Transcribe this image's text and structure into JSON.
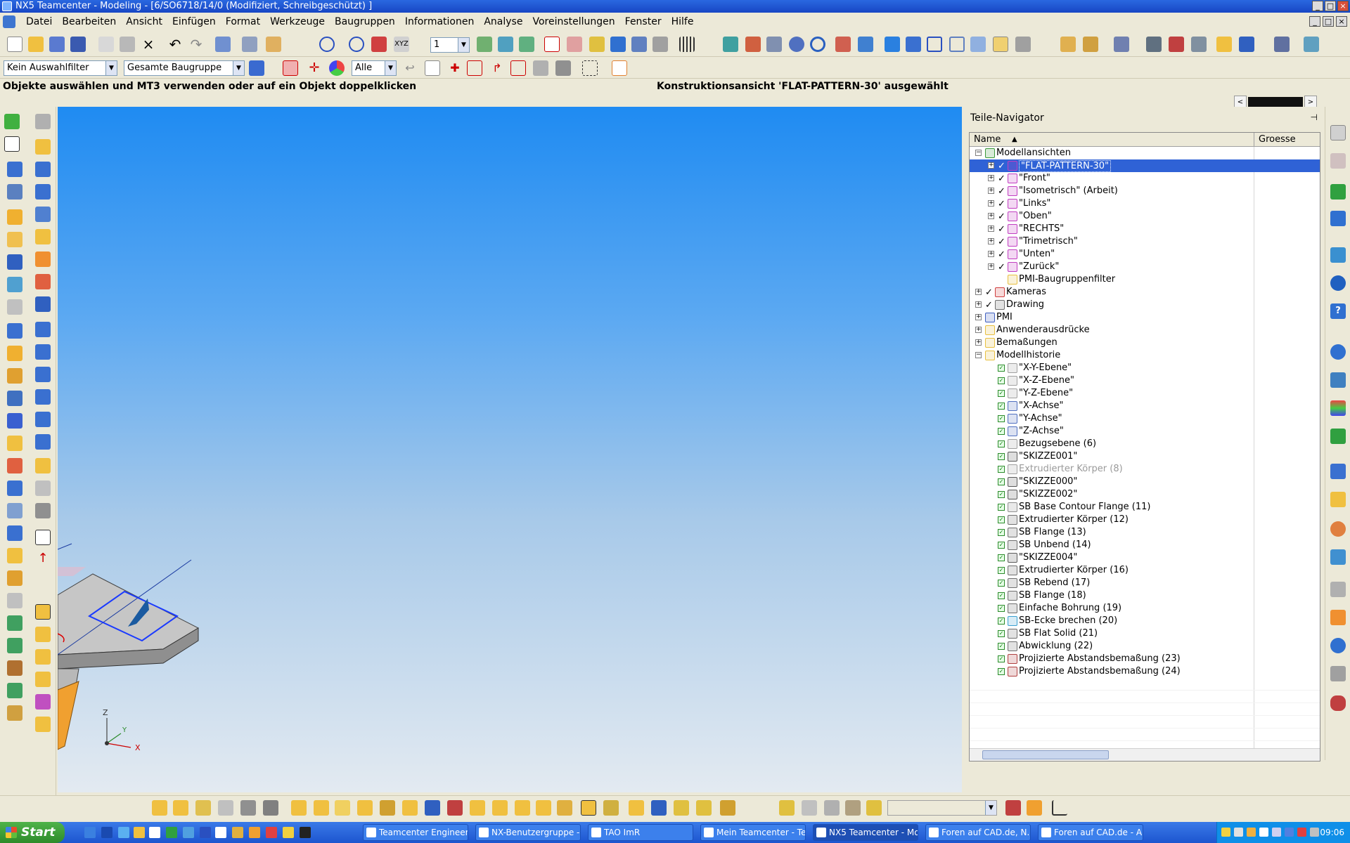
{
  "window": {
    "title": "NX5 Teamcenter - Modeling - [6/SO6718/14/0 (Modifiziert, Schreibgeschützt) ]",
    "min": "_",
    "max": "□",
    "close": "×"
  },
  "menubar": {
    "items": [
      "Datei",
      "Bearbeiten",
      "Ansicht",
      "Einfügen",
      "Format",
      "Werkzeuge",
      "Baugruppen",
      "Informationen",
      "Analyse",
      "Voreinstellungen",
      "Fenster",
      "Hilfe"
    ]
  },
  "selection_bar": {
    "filter": "Kein Auswahlfilter",
    "scope": "Gesamte Baugruppe",
    "type": "Alle",
    "layer": "1"
  },
  "status": {
    "prompt": "Objekte auswählen und MT3 verwenden oder auf ein Objekt doppelklicken",
    "message": "Konstruktionsansicht 'FLAT-PATTERN-30' ausgewählt"
  },
  "triad": {
    "z": "Z",
    "y": "Y",
    "x": "X"
  },
  "navigator": {
    "title": "Teile-Navigator",
    "pin": "⊣",
    "columns": {
      "name": "Name",
      "size": "Groesse",
      "sort": "▲"
    },
    "rows": [
      {
        "label": "Modellansichten",
        "level": 0,
        "exp": "−",
        "icon": "views-icon",
        "color": "#3a9a3a"
      },
      {
        "label": "\"FLAT-PATTERN-30\"",
        "level": 1,
        "exp": "+",
        "check": "✓",
        "icon": "view-icon",
        "color": "#c23ec2",
        "selected": true
      },
      {
        "label": "\"Front\"",
        "level": 1,
        "exp": "+",
        "check": "✓",
        "icon": "view-icon",
        "color": "#c23ec2"
      },
      {
        "label": "\"Isometrisch\" (Arbeit)",
        "level": 1,
        "exp": "+",
        "check": "✓",
        "icon": "view-icon",
        "color": "#c23ec2"
      },
      {
        "label": "\"Links\"",
        "level": 1,
        "exp": "+",
        "check": "✓",
        "icon": "view-icon",
        "color": "#c23ec2"
      },
      {
        "label": "\"Oben\"",
        "level": 1,
        "exp": "+",
        "check": "✓",
        "icon": "view-icon",
        "color": "#c23ec2"
      },
      {
        "label": "\"RECHTS\"",
        "level": 1,
        "exp": "+",
        "check": "✓",
        "icon": "view-icon",
        "color": "#c23ec2"
      },
      {
        "label": "\"Trimetrisch\"",
        "level": 1,
        "exp": "+",
        "check": "✓",
        "icon": "view-icon",
        "color": "#c23ec2"
      },
      {
        "label": "\"Unten\"",
        "level": 1,
        "exp": "+",
        "check": "✓",
        "icon": "view-icon",
        "color": "#c23ec2"
      },
      {
        "label": "\"Zurück\"",
        "level": 1,
        "exp": "+",
        "check": "✓",
        "icon": "view-icon",
        "color": "#c23ec2"
      },
      {
        "label": "PMI-Baugruppenfilter",
        "level": 1,
        "icon": "folder-icon",
        "color": "#e8c040"
      },
      {
        "label": "Kameras",
        "level": 0,
        "exp": "+",
        "check": "✓",
        "icon": "camera-icon",
        "color": "#d04040"
      },
      {
        "label": "Drawing",
        "level": 0,
        "exp": "+",
        "check": "✓",
        "icon": "drawing-icon",
        "color": "#707070"
      },
      {
        "label": "PMI",
        "level": 0,
        "exp": "+",
        "icon": "pmi-icon",
        "color": "#4060c0"
      },
      {
        "label": "Anwenderausdrücke",
        "level": 0,
        "exp": "+",
        "icon": "folder-icon",
        "color": "#e8c040"
      },
      {
        "label": "Bemaßungen",
        "level": 0,
        "exp": "+",
        "icon": "folder-icon",
        "color": "#e8c040"
      },
      {
        "label": "Modellhistorie",
        "level": 0,
        "exp": "−",
        "icon": "folder-open-icon",
        "color": "#e8c040"
      },
      {
        "label": "\"X-Y-Ebene\"",
        "level": 2,
        "box": true,
        "icon": "datum-plane-icon",
        "color": "#a0a0a0"
      },
      {
        "label": "\"X-Z-Ebene\"",
        "level": 2,
        "box": true,
        "icon": "datum-plane-icon",
        "color": "#a0a0a0"
      },
      {
        "label": "\"Y-Z-Ebene\"",
        "level": 2,
        "box": true,
        "icon": "datum-plane-icon",
        "color": "#a0a0a0"
      },
      {
        "label": "\"X-Achse\"",
        "level": 2,
        "box": true,
        "icon": "datum-axis-icon",
        "color": "#5070c0"
      },
      {
        "label": "\"Y-Achse\"",
        "level": 2,
        "box": true,
        "icon": "datum-axis-icon",
        "color": "#5070c0"
      },
      {
        "label": "\"Z-Achse\"",
        "level": 2,
        "box": true,
        "icon": "datum-axis-icon",
        "color": "#5070c0"
      },
      {
        "label": "Bezugsebene (6)",
        "level": 2,
        "box": true,
        "icon": "datum-plane-icon",
        "color": "#a0a0a0"
      },
      {
        "label": "\"SKIZZE001\"",
        "level": 2,
        "box": true,
        "icon": "sketch-icon",
        "color": "#5a5a5a"
      },
      {
        "label": "Extrudierter Körper (8)",
        "level": 2,
        "box": true,
        "icon": "extrude-icon",
        "color": "#a0a0a0",
        "dim": true
      },
      {
        "label": "\"SKIZZE000\"",
        "level": 2,
        "box": true,
        "icon": "sketch-icon",
        "color": "#5a5a5a"
      },
      {
        "label": "\"SKIZZE002\"",
        "level": 2,
        "box": true,
        "icon": "sketch-icon",
        "color": "#5a5a5a"
      },
      {
        "label": "SB Base Contour Flange (11)",
        "level": 2,
        "box": true,
        "icon": "contour-flange-icon",
        "color": "#909090"
      },
      {
        "label": "Extrudierter Körper (12)",
        "level": 2,
        "box": true,
        "icon": "extrude-icon",
        "color": "#707070"
      },
      {
        "label": "SB Flange (13)",
        "level": 2,
        "box": true,
        "icon": "flange-icon",
        "color": "#707070"
      },
      {
        "label": "SB Unbend (14)",
        "level": 2,
        "box": true,
        "icon": "unbend-icon",
        "color": "#707070"
      },
      {
        "label": "\"SKIZZE004\"",
        "level": 2,
        "box": true,
        "icon": "sketch-icon",
        "color": "#5a5a5a"
      },
      {
        "label": "Extrudierter Körper (16)",
        "level": 2,
        "box": true,
        "icon": "extrude-icon",
        "color": "#707070"
      },
      {
        "label": "SB Rebend (17)",
        "level": 2,
        "box": true,
        "icon": "rebend-icon",
        "color": "#707070"
      },
      {
        "label": "SB Flange (18)",
        "level": 2,
        "box": true,
        "icon": "flange-icon",
        "color": "#707070"
      },
      {
        "label": "Einfache Bohrung (19)",
        "level": 2,
        "box": true,
        "icon": "hole-icon",
        "color": "#707070"
      },
      {
        "label": "SB-Ecke brechen (20)",
        "level": 2,
        "box": true,
        "icon": "corner-break-icon",
        "color": "#3aa0d0"
      },
      {
        "label": "SB Flat Solid (21)",
        "level": 2,
        "box": true,
        "icon": "flat-solid-icon",
        "color": "#707070"
      },
      {
        "label": "Abwicklung (22)",
        "level": 2,
        "box": true,
        "icon": "flat-pattern-icon",
        "color": "#707070"
      },
      {
        "label": "Projizierte Abstandsbemaßung (23)",
        "level": 2,
        "box": true,
        "icon": "dimension-icon",
        "color": "#b04040"
      },
      {
        "label": "Projizierte Abstandsbemaßung (24)",
        "level": 2,
        "box": true,
        "icon": "dimension-icon",
        "color": "#b04040"
      }
    ]
  },
  "taskbar": {
    "start": "Start",
    "tasks": [
      {
        "label": "Teamcenter Engineeri...",
        "icon": "folder-icon",
        "active": false
      },
      {
        "label": "NX-Benutzergruppe - ...",
        "icon": "browser-icon",
        "active": false
      },
      {
        "label": "TAO ImR",
        "icon": "console-icon",
        "active": false
      },
      {
        "label": "Mein Teamcenter - Te...",
        "icon": "teamcenter-icon",
        "active": false
      },
      {
        "label": "NX5 Teamcenter - Mo...",
        "icon": "nx-icon",
        "active": true
      },
      {
        "label": "Foren auf CAD.de, N...",
        "icon": "browser-icon",
        "active": false
      },
      {
        "label": "Foren auf CAD.de - A...",
        "icon": "browser-icon",
        "active": false
      }
    ],
    "clock": "09:06"
  }
}
